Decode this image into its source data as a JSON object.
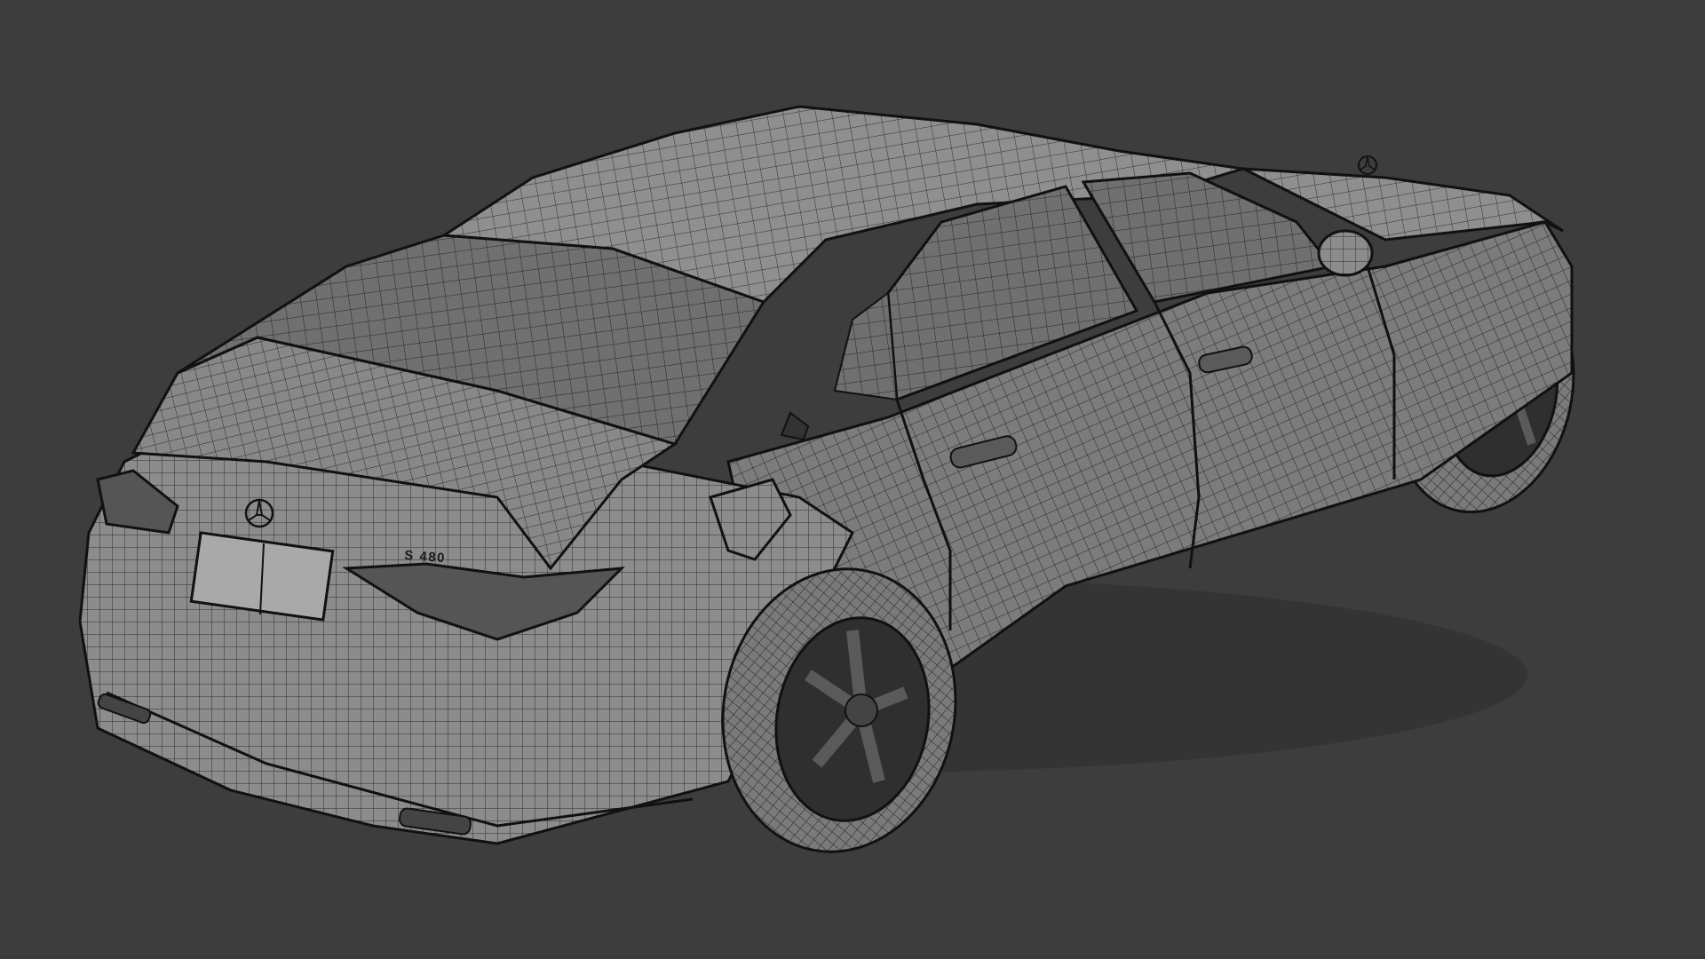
{
  "viewport": {
    "background_color": "#3d3d3d",
    "render_mode": "wireframe",
    "subject": "sedan-3d-model"
  },
  "model": {
    "trunk_badge_text": "S 480",
    "body_color": "#8a8a8a",
    "wire_color": "#2a2a2a",
    "glass_color": "#6c6c6c",
    "tire_color": "#7a7a7a",
    "outline_color": "#111111"
  }
}
